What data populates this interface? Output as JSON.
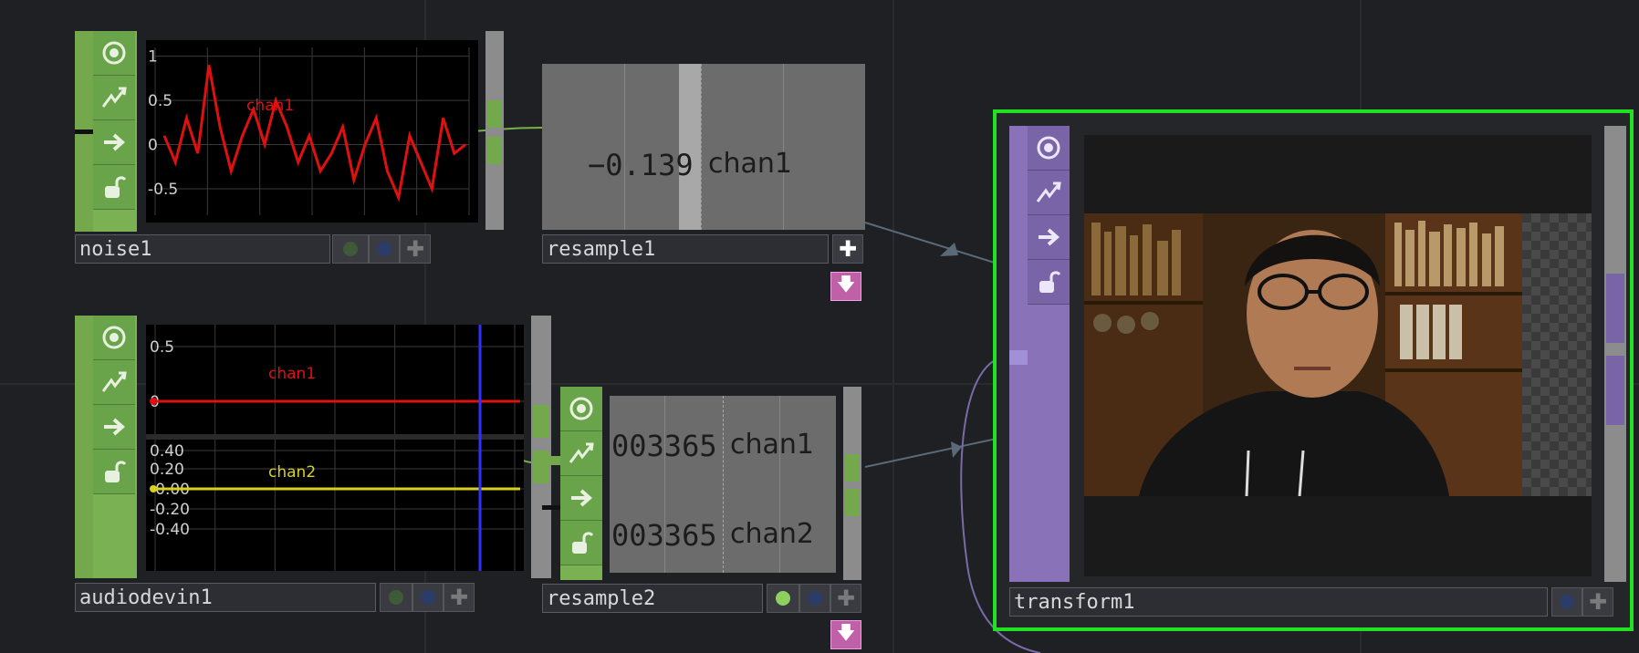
{
  "colors": {
    "background": "#1f2024",
    "chop_green": "#74a84c",
    "top_purple": "#8a72b8",
    "selected_border": "#22e022",
    "chan1_red": "#e01010",
    "chan2_yellow": "#d8d020",
    "playhead_blue": "#3030ff"
  },
  "sidebar_icons": [
    "viewer-icon",
    "bypass-icon",
    "arrow-right-icon",
    "lock-icon"
  ],
  "noise1": {
    "name": "noise1",
    "chan_label": "chan1",
    "yticks": [
      "1",
      "0.5",
      "0",
      "-0.5"
    ],
    "chart_data": {
      "type": "line",
      "series": [
        {
          "name": "chan1",
          "values": [
            0.1,
            -0.2,
            0.3,
            -0.1,
            0.9,
            0.2,
            -0.3,
            0.1,
            0.4,
            0.0,
            0.5,
            0.2,
            -0.2,
            0.1,
            -0.3,
            -0.1,
            0.2,
            -0.4,
            0.0,
            0.3,
            -0.3,
            -0.6,
            0.1,
            -0.2,
            -0.5,
            0.3,
            -0.1,
            0.0
          ]
        }
      ],
      "ylim": [
        -0.8,
        1.1
      ]
    }
  },
  "resample1": {
    "name": "resample1",
    "value": "−0.139",
    "chan": "chan1"
  },
  "audiodevin1": {
    "name": "audiodevin1",
    "chan1_label": "chan1",
    "chan2_label": "chan2",
    "yticks_top": [
      "0.5",
      "0"
    ],
    "yticks_bottom": [
      "0.40",
      "0.20",
      "-0.00",
      "-0.20",
      "-0.40"
    ]
  },
  "resample2": {
    "name": "resample2",
    "row1_value": "003365",
    "row1_chan": "chan1",
    "row2_value": "003365",
    "row2_chan": "chan2"
  },
  "transform1": {
    "name": "transform1"
  }
}
